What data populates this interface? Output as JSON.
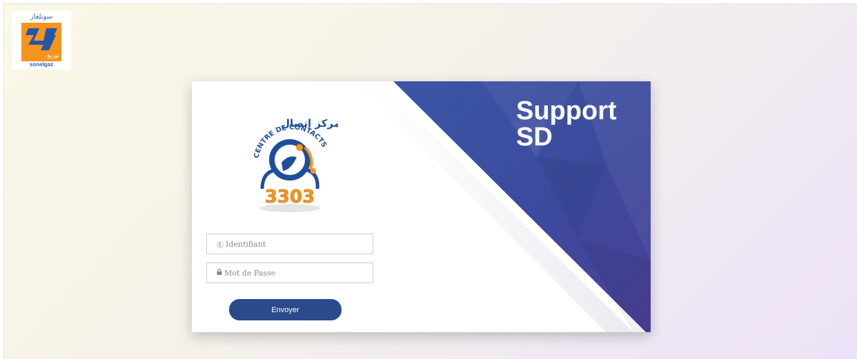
{
  "brand": {
    "arabic_name": "سونلغاز",
    "latin_name": "sonelgaz",
    "color": "#f7941d"
  },
  "card": {
    "title_line1": "Support",
    "title_line2": "SD",
    "accent_color": "#3a4fa0"
  },
  "contact_logo": {
    "arabic_text": "مركز إتصال",
    "latin_text": "CENTRE DE CONTACTS",
    "number": "3303",
    "icon": "headset-operator-icon"
  },
  "form": {
    "username": {
      "placeholder": "Identifiant",
      "value": "",
      "icon": "user-circle-icon"
    },
    "password": {
      "placeholder": "Mot de Passe",
      "value": "",
      "icon": "lock-icon"
    },
    "submit_label": "Envoyer"
  }
}
